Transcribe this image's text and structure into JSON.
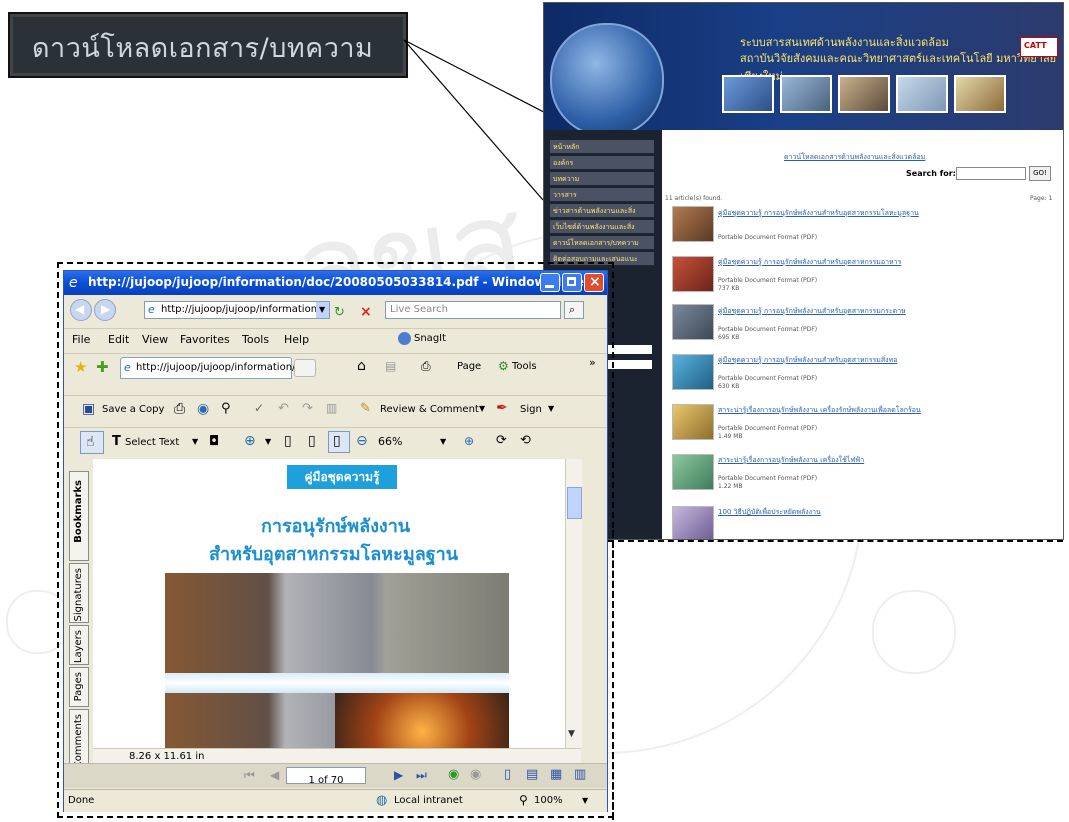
{
  "callout": {
    "label": "ดาวน์โหลดเอกสาร/บทความ"
  },
  "website": {
    "banner_title_1": "ระบบสารสนเทศด้านพลังงานและสิ่งแวดล้อม",
    "banner_title_2": "สถาบันวิจัยสังคมและคณะวิทยาศาสตร์และเทคโนโลยี มหาวิทยาลัยเชียงใหม่",
    "logo": "CATT",
    "nav_items": [
      "หน้าหลัก",
      "องค์กร",
      "บทความ",
      "วารสาร",
      "ข่าวสารด้านพลังงานและสิ่งแวดล้อม",
      "เว็บไซต์ด้านพลังงานและสิ่งแวดล้อม",
      "ดาวน์โหลดเอกสาร/บทความ",
      "ติดต่อสอบถามและเสนอแนะ"
    ],
    "section_link": "ดาวน์โหลดเอกสารด้านพลังงานและสิ่งแวดล้อม",
    "search_label": "Search for:",
    "search_button": "GO!",
    "found_text": "11 article(s) found.",
    "page_text": "Page: 1",
    "articles": [
      {
        "title": "คู่มือชุดความรู้ การอนุรักษ์พลังงานสำหรับอุตสาหกรรมโลหะมูลฐาน",
        "type": "Portable Document Format (PDF)",
        "size": ""
      },
      {
        "title": "คู่มือชุดความรู้ การอนุรักษ์พลังงานสำหรับอุตสาหกรรมอาหาร",
        "type": "Portable Document Format (PDF)",
        "size": "737 KB"
      },
      {
        "title": "คู่มือชุดความรู้ การอนุรักษ์พลังงานสำหรับอุตสาหกรรมกระดาษ",
        "type": "Portable Document Format (PDF)",
        "size": "695 KB"
      },
      {
        "title": "คู่มือชุดความรู้ การอนุรักษ์พลังงานสำหรับอุตสาหกรรมสิ่งทอ",
        "type": "Portable Document Format (PDF)",
        "size": "630 KB"
      },
      {
        "title": "สาระน่ารู้เรื่องการอนุรักษ์พลังงาน เครื่องรักษ์พลังงานเพื่อลดโลกร้อน",
        "type": "Portable Document Format (PDF)",
        "size": "1.49 MB"
      },
      {
        "title": "สาระน่ารู้เรื่องการอนุรักษ์พลังงาน เครื่องใช้ไฟฟ้า",
        "type": "Portable Document Format (PDF)",
        "size": "1.22 MB"
      },
      {
        "title": "100 วิธีปฏิบัติเพื่อประหยัดพลังงาน",
        "type": "",
        "size": ""
      }
    ]
  },
  "ie": {
    "title": "http://jujoop/jujoop/information/doc/20080505033814.pdf - Windows Inter...",
    "address": "http://jujoop/jujoop/information/d",
    "search_placeholder": "Live Search",
    "menu": [
      "File",
      "Edit",
      "View",
      "Favorites",
      "Tools",
      "Help"
    ],
    "snagit": "SnagIt",
    "tab_label": "http://jujoop/jujoop/information/do...",
    "page_label": "Page",
    "tools_label": "Tools",
    "save_copy": "Save a Copy",
    "review_comment": "Review & Comment",
    "sign": "Sign",
    "select_text": "Select Text",
    "zoom": "66%",
    "side_tabs": [
      "Bookmarks",
      "Signatures",
      "Layers",
      "Pages",
      "Comments"
    ],
    "doc_badge": "คู่มือชุดความรู้",
    "doc_title_1": "การอนุรักษ์พลังงาน",
    "doc_title_2": "สำหรับอุตสาหกรรมโลหะมูลฐาน",
    "page_size": "8.26 x 11.61 in",
    "page_counter": "1 of 70",
    "status_left": "Done",
    "status_zone": "Local intranet",
    "status_zoom": "100%"
  },
  "colors": {
    "title_bar": "#0b4fd6",
    "xp_face": "#ece9d8",
    "link": "#2a5fb0"
  }
}
